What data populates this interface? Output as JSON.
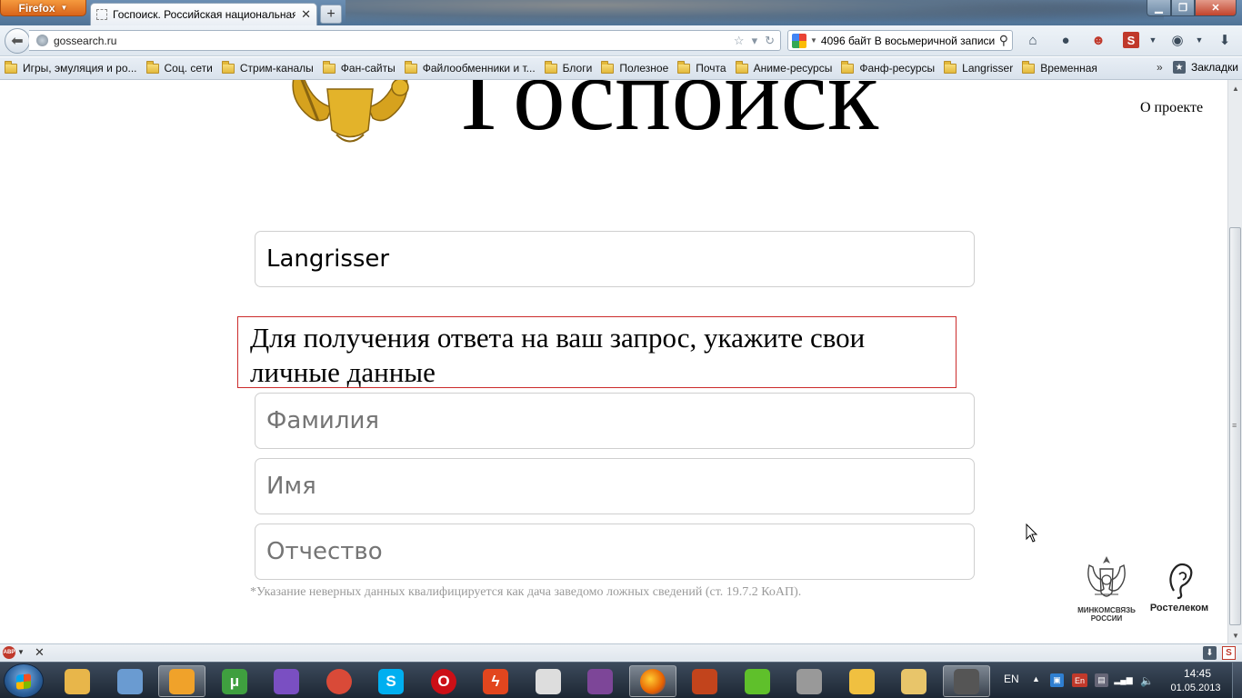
{
  "browser": {
    "app_menu_label": "Firefox",
    "tab_title": "Госпоиск. Российская национальная п...",
    "new_tab_label": "+",
    "url": "gossearch.ru",
    "search_query": "4096 байт В восьмеричной записи"
  },
  "bookmarks": {
    "items": [
      {
        "label": "Игры, эмуляция и ро..."
      },
      {
        "label": "Соц. сети"
      },
      {
        "label": "Стрим-каналы"
      },
      {
        "label": "Фан-сайты"
      },
      {
        "label": "Файлообменники и т..."
      },
      {
        "label": "Блоги"
      },
      {
        "label": "Полезное"
      },
      {
        "label": "Почта"
      },
      {
        "label": "Аниме-ресурсы"
      },
      {
        "label": "Фанф-ресурсы"
      },
      {
        "label": "Langrisser"
      },
      {
        "label": "Временная"
      }
    ],
    "more_label": "»",
    "all_bookmarks_label": "Закладки"
  },
  "page": {
    "logo_text": "Госпоиск",
    "about_link": "О проекте",
    "query_value": "Langrisser",
    "notice": "Для получения ответа на ваш запрос, укажите свои личные данные",
    "surname_placeholder": "Фамилия",
    "firstname_placeholder": "Имя",
    "patronymic_placeholder": "Отчество",
    "footnote": "*Указание неверных данных квалифицируется как дача заведомо ложных сведений (ст. 19.7.2 КоАП).",
    "partner1_label_line1": "МИНКОМСВЯЗЬ",
    "partner1_label_line2": "РОССИИ",
    "partner2_label": "Ростелеком"
  },
  "addon_bar": {
    "abp_label": "ABP"
  },
  "taskbar": {
    "apps": [
      {
        "icon": "file-explorer-icon",
        "color": "#e8b64a"
      },
      {
        "icon": "paint-icon",
        "color": "#6a9bd1"
      },
      {
        "icon": "aimp-icon",
        "color": "#f0a22a"
      },
      {
        "icon": "utorrent-icon",
        "color": "#3f9f3f",
        "glyph": "μ"
      },
      {
        "icon": "color-palette-icon",
        "color": "#7a4fc2"
      },
      {
        "icon": "chrome-icon",
        "color": "#d94a38"
      },
      {
        "icon": "skype-icon",
        "color": "#00aff0",
        "glyph": "S"
      },
      {
        "icon": "opera-icon",
        "color": "#cc0f16",
        "glyph": "O"
      },
      {
        "icon": "flash-icon",
        "color": "#e2461e",
        "glyph": "ϟ"
      },
      {
        "icon": "clock-app-icon",
        "color": "#dddddd"
      },
      {
        "icon": "tor-icon",
        "color": "#7d4698"
      },
      {
        "icon": "firefox-icon",
        "color": "#e66000"
      },
      {
        "icon": "xsplit-icon",
        "color": "#c2441c"
      },
      {
        "icon": "icq-icon",
        "color": "#5fc02b"
      },
      {
        "icon": "tools-icon",
        "color": "#999999"
      },
      {
        "icon": "mail-icon",
        "color": "#f0c040"
      },
      {
        "icon": "folder-icon",
        "color": "#e8c56a"
      },
      {
        "icon": "image-viewer-icon",
        "color": "#555555"
      }
    ],
    "language": "EN",
    "keyboard_layout": "En",
    "time": "14:45",
    "date": "01.05.2013"
  },
  "colors": {
    "notice_border": "#cc2b2b",
    "footnote_text": "#9a9a9a",
    "field_border": "#cfcfcf"
  }
}
